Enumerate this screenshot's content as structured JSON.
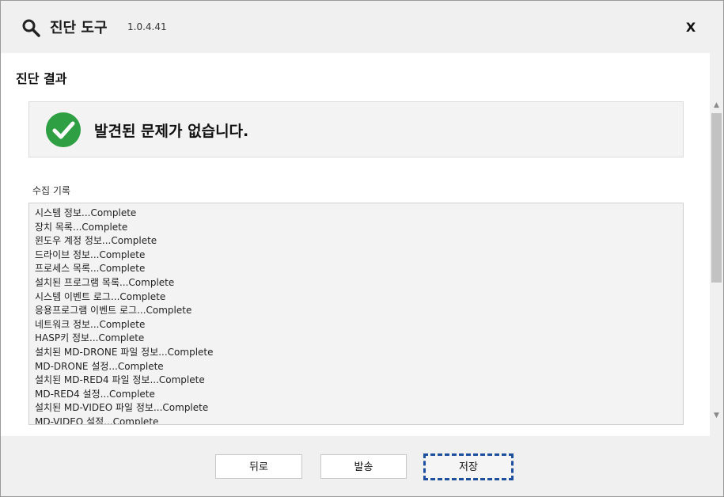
{
  "window": {
    "title": "진단 도구",
    "version": "1.0.4.41",
    "close_label": "X"
  },
  "result": {
    "section_title": "진단 결과",
    "message": "발견된 문제가 없습니다.",
    "status_color": "#2ea043"
  },
  "log": {
    "label": "수집 기록",
    "lines": [
      "시스템 정보...Complete",
      "장치 목록...Complete",
      "윈도우 계정 정보...Complete",
      "드라이브 정보...Complete",
      "프로세스 목록...Complete",
      "설치된 프로그램 목록...Complete",
      "시스템 이벤트 로그...Complete",
      "응용프로그램 이벤트 로그...Complete",
      "네트워크 정보...Complete",
      "HASP키 정보...Complete",
      "설치된 MD-DRONE 파일 정보...Complete",
      "MD-DRONE 설정...Complete",
      "설치된 MD-RED4 파일 정보...Complete",
      "MD-RED4 설정...Complete",
      "설치된 MD-VIDEO 파일 정보...Complete",
      "MD-VIDEO 설정...Complete"
    ]
  },
  "buttons": {
    "back": "뒤로",
    "send": "발송",
    "save": "저장"
  }
}
